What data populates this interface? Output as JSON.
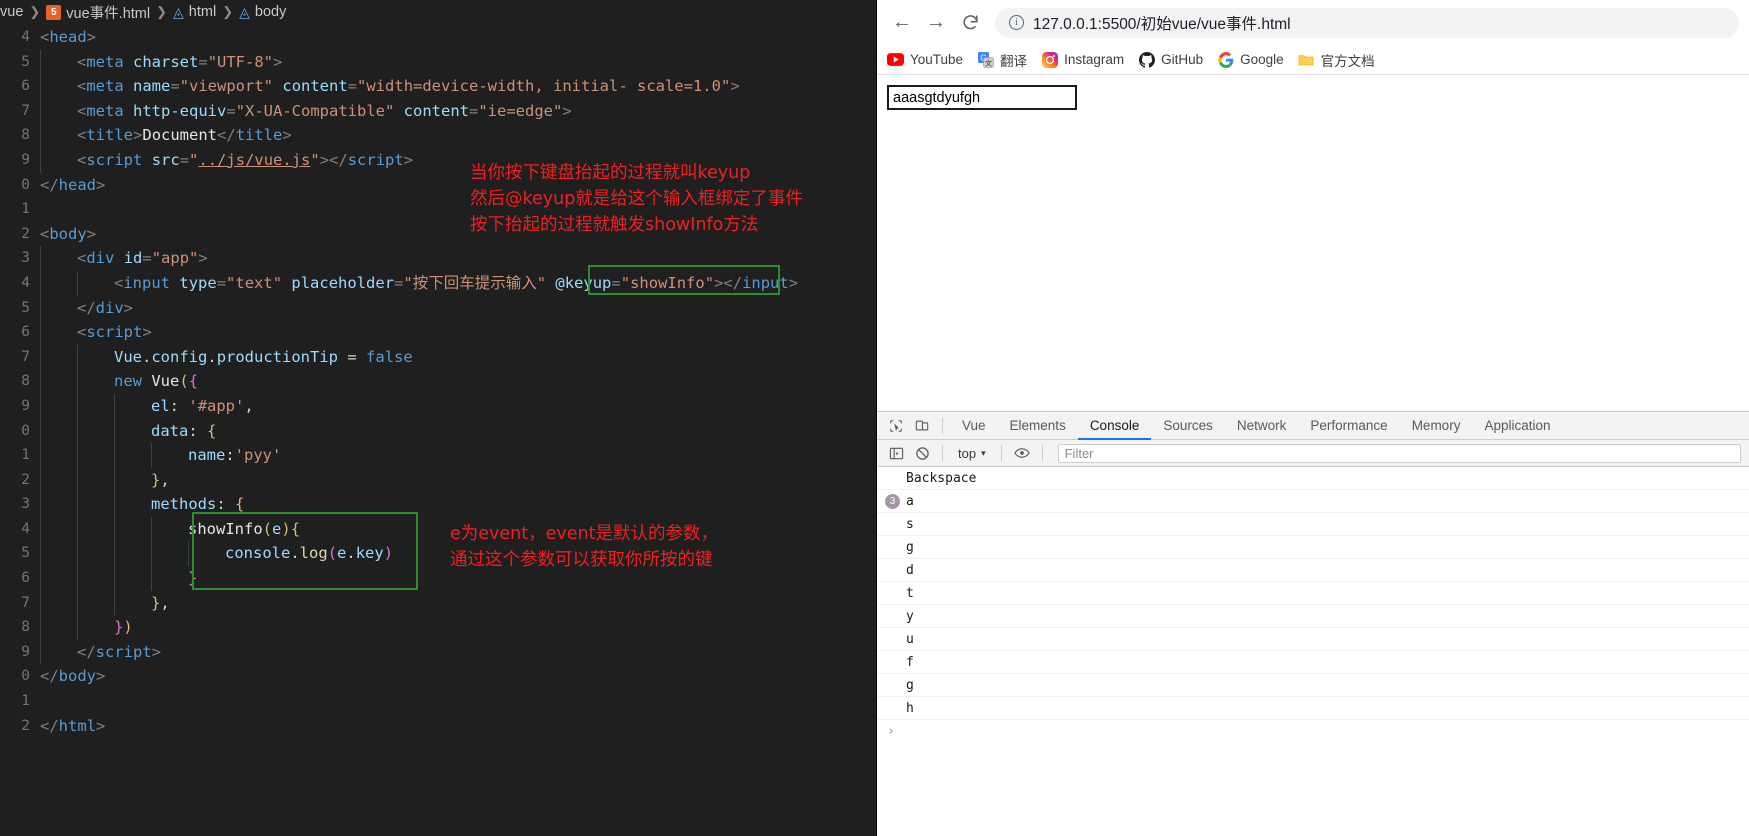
{
  "editor": {
    "breadcrumb": {
      "root": "vue",
      "file": "vue事件.html",
      "node1": "html",
      "node2": "body",
      "html_icon": "html5-icon",
      "cube_icon": "symbol-cube-icon",
      "separator": "❯"
    },
    "lines": [
      {
        "num": "4",
        "indent": 0,
        "html": "<span class='brack'>&lt;</span><span class='tag'>head</span><span class='brack'>&gt;</span>"
      },
      {
        "num": "5",
        "indent": 1,
        "html": "<span class='brack'>&lt;</span><span class='tag'>meta</span> <span class='attr'>charset</span><span class='brack'>=</span><span class='str'>\"UTF-8\"</span><span class='brack'>&gt;</span>"
      },
      {
        "num": "6",
        "indent": 1,
        "html": "<span class='brack'>&lt;</span><span class='tag'>meta</span> <span class='attr'>name</span><span class='brack'>=</span><span class='str'>\"viewport\"</span> <span class='attr'>content</span><span class='brack'>=</span><span class='str'>\"width=device-width, initial- scale=1.0\"</span><span class='brack'>&gt;</span>"
      },
      {
        "num": "7",
        "indent": 1,
        "html": "<span class='brack'>&lt;</span><span class='tag'>meta</span> <span class='attr'>http-equiv</span><span class='brack'>=</span><span class='str'>\"X-UA-Compatible\"</span> <span class='attr'>content</span><span class='brack'>=</span><span class='str'>\"ie=edge\"</span><span class='brack'>&gt;</span>"
      },
      {
        "num": "8",
        "indent": 1,
        "html": "<span class='brack'>&lt;</span><span class='tag'>title</span><span class='brack'>&gt;</span><span class='white'>Document</span><span class='brack'>&lt;/</span><span class='tag'>title</span><span class='brack'>&gt;</span>"
      },
      {
        "num": "9",
        "indent": 1,
        "html": "<span class='brack'>&lt;</span><span class='tag'>script</span> <span class='attr'>src</span><span class='brack'>=</span><span class='str'>\"</span><span class='link'>../js/vue.js</span><span class='str'>\"</span><span class='brack'>&gt;&lt;/</span><span class='tag'>script</span><span class='brack'>&gt;</span>"
      },
      {
        "num": "0",
        "indent": 0,
        "html": "<span class='brack'>&lt;/</span><span class='tag'>head</span><span class='brack'>&gt;</span>"
      },
      {
        "num": "1",
        "indent": 0,
        "html": ""
      },
      {
        "num": "2",
        "indent": 0,
        "html": "<span class='brack'>&lt;</span><span class='tag'>body</span><span class='brack'>&gt;</span>"
      },
      {
        "num": "3",
        "indent": 1,
        "html": "<span class='brack'>&lt;</span><span class='tag'>div</span> <span class='attr'>id</span><span class='brack'>=</span><span class='str'>\"app\"</span><span class='brack'>&gt;</span>"
      },
      {
        "num": "4",
        "indent": 2,
        "html": "<span class='brack'>&lt;</span><span class='tag'>input</span> <span class='attr'>type</span><span class='brack'>=</span><span class='str'>\"text\"</span> <span class='attr'>placeholder</span><span class='brack'>=</span><span class='str'>\"按下回车提示输入\"</span> <span class='attr'>@keyup</span><span class='brack'>=</span><span class='str'>\"showInfo\"</span><span class='brack'>&gt;&lt;/</span><span class='tag'>input</span><span class='brack'>&gt;</span>"
      },
      {
        "num": "5",
        "indent": 1,
        "html": "<span class='brack'>&lt;/</span><span class='tag'>div</span><span class='brack'>&gt;</span>"
      },
      {
        "num": "6",
        "indent": 1,
        "html": "<span class='brack'>&lt;</span><span class='tag'>script</span><span class='brack'>&gt;</span>"
      },
      {
        "num": "7",
        "indent": 2,
        "html": "<span class='prop'>Vue</span><span class='plain'>.</span><span class='prop'>config</span><span class='plain'>.</span><span class='prop'>productionTip</span> <span class='plain'>=</span> <span class='kw'>false</span>"
      },
      {
        "num": "8",
        "indent": 2,
        "html": "<span class='kw'>new</span> <span class='white'>Vue</span><span class='punc-y'>(</span><span class='punc-p'>{</span>"
      },
      {
        "num": "9",
        "indent": 3,
        "html": "<span class='prop'>el</span><span class='plain'>:</span> <span class='str'>'#app'</span><span class='plain'>,</span>"
      },
      {
        "num": "0",
        "indent": 3,
        "html": "<span class='prop'>data</span><span class='plain'>:</span> <span class='punc-y'>{</span>"
      },
      {
        "num": "1",
        "indent": 4,
        "html": "<span class='prop'>name</span><span class='plain'>:</span><span class='str'>'pyy'</span>"
      },
      {
        "num": "2",
        "indent": 3,
        "html": "<span class='punc-y'>}</span><span class='plain'>,</span>"
      },
      {
        "num": "3",
        "indent": 3,
        "html": "<span class='prop'>methods</span><span class='plain'>:</span> <span class='punc-y'>{</span>"
      },
      {
        "num": "4",
        "indent": 4,
        "html": "<span class='white'>showInfo</span><span class='punc-y'>(</span><span class='varname'>e</span><span class='punc-y'>)</span><span class='punc-y'>{</span>"
      },
      {
        "num": "5",
        "indent": 5,
        "html": "<span class='prop'>console</span><span class='plain'>.</span><span class='fn'>log</span><span class='punc-p'>(</span><span class='varname'>e</span><span class='plain'>.</span><span class='prop'>key</span><span class='punc-p'>)</span>"
      },
      {
        "num": "6",
        "indent": 4,
        "html": "<span class='punc-y'>}</span>"
      },
      {
        "num": "7",
        "indent": 3,
        "html": "<span class='punc-y'>}</span><span class='plain'>,</span>"
      },
      {
        "num": "8",
        "indent": 2,
        "html": "<span class='punc-p'>}</span><span class='punc-y'>)</span>"
      },
      {
        "num": "9",
        "indent": 1,
        "html": "<span class='brack'>&lt;/</span><span class='tag'>script</span><span class='brack'>&gt;</span>"
      },
      {
        "num": "0",
        "indent": 0,
        "html": "<span class='brack'>&lt;/</span><span class='tag'>body</span><span class='brack'>&gt;</span>"
      },
      {
        "num": "1",
        "indent": 0,
        "html": ""
      },
      {
        "num": "2",
        "indent": 0,
        "html": "<span class='brack'>&lt;/</span><span class='tag'>html</span><span class='brack'>&gt;</span>"
      }
    ],
    "annotations": {
      "color": "#f02020",
      "note1_line1": "当你按下键盘抬起的过程就叫keyup",
      "note1_line2": "然后@keyup就是给这个输入框绑定了事件",
      "note1_line3": "按下抬起的过程就触发showInfo方法",
      "note2_line1": "e为event，event是默认的参数，",
      "note2_line2": "通过这个参数可以获取你所按的键"
    },
    "highlight_boxes": {
      "color": "#2e8b2e",
      "box1_label": "keyup-binding-highlight",
      "box2_label": "showinfo-method-highlight"
    }
  },
  "browser": {
    "nav": {
      "back_icon": "arrow-left-icon",
      "forward_icon": "arrow-right-icon",
      "reload_icon": "reload-icon",
      "info_icon": "info-circle-icon",
      "url": "127.0.0.1:5500/初始vue/vue事件.html"
    },
    "bookmarks": [
      {
        "label": "YouTube",
        "icon": "youtube-icon"
      },
      {
        "label": "翻译",
        "icon": "google-translate-icon"
      },
      {
        "label": "Instagram",
        "icon": "instagram-icon"
      },
      {
        "label": "GitHub",
        "icon": "github-icon"
      },
      {
        "label": "Google",
        "icon": "google-icon"
      },
      {
        "label": "官方文档",
        "icon": "folder-icon"
      }
    ],
    "page": {
      "input_value": "aaasgtdyufgh",
      "input_placeholder": "按下回车提示输入"
    },
    "devtools": {
      "inspect_icon": "inspect-element-icon",
      "device_icon": "device-toolbar-icon",
      "tabs": [
        {
          "label": "Vue",
          "active": false
        },
        {
          "label": "Elements",
          "active": false
        },
        {
          "label": "Console",
          "active": true
        },
        {
          "label": "Sources",
          "active": false
        },
        {
          "label": "Network",
          "active": false
        },
        {
          "label": "Performance",
          "active": false
        },
        {
          "label": "Memory",
          "active": false
        },
        {
          "label": "Application",
          "active": false
        }
      ],
      "toolbar": {
        "sidebar_icon": "console-sidebar-icon",
        "clear_icon": "clear-console-icon",
        "context": "top",
        "context_caret": "▾",
        "eye_icon": "live-expression-icon",
        "filter_placeholder": "Filter"
      },
      "console_rows": [
        {
          "badge": "",
          "text": "Backspace"
        },
        {
          "badge": "3",
          "text": "a"
        },
        {
          "badge": "",
          "text": "s"
        },
        {
          "badge": "",
          "text": "g"
        },
        {
          "badge": "",
          "text": "d"
        },
        {
          "badge": "",
          "text": "t"
        },
        {
          "badge": "",
          "text": "y"
        },
        {
          "badge": "",
          "text": "u"
        },
        {
          "badge": "",
          "text": "f"
        },
        {
          "badge": "",
          "text": "g"
        },
        {
          "badge": "",
          "text": "h"
        }
      ],
      "prompt_symbol": "›",
      "badge_color": "#a694a6",
      "active_tab_color": "#1a73e8"
    }
  }
}
